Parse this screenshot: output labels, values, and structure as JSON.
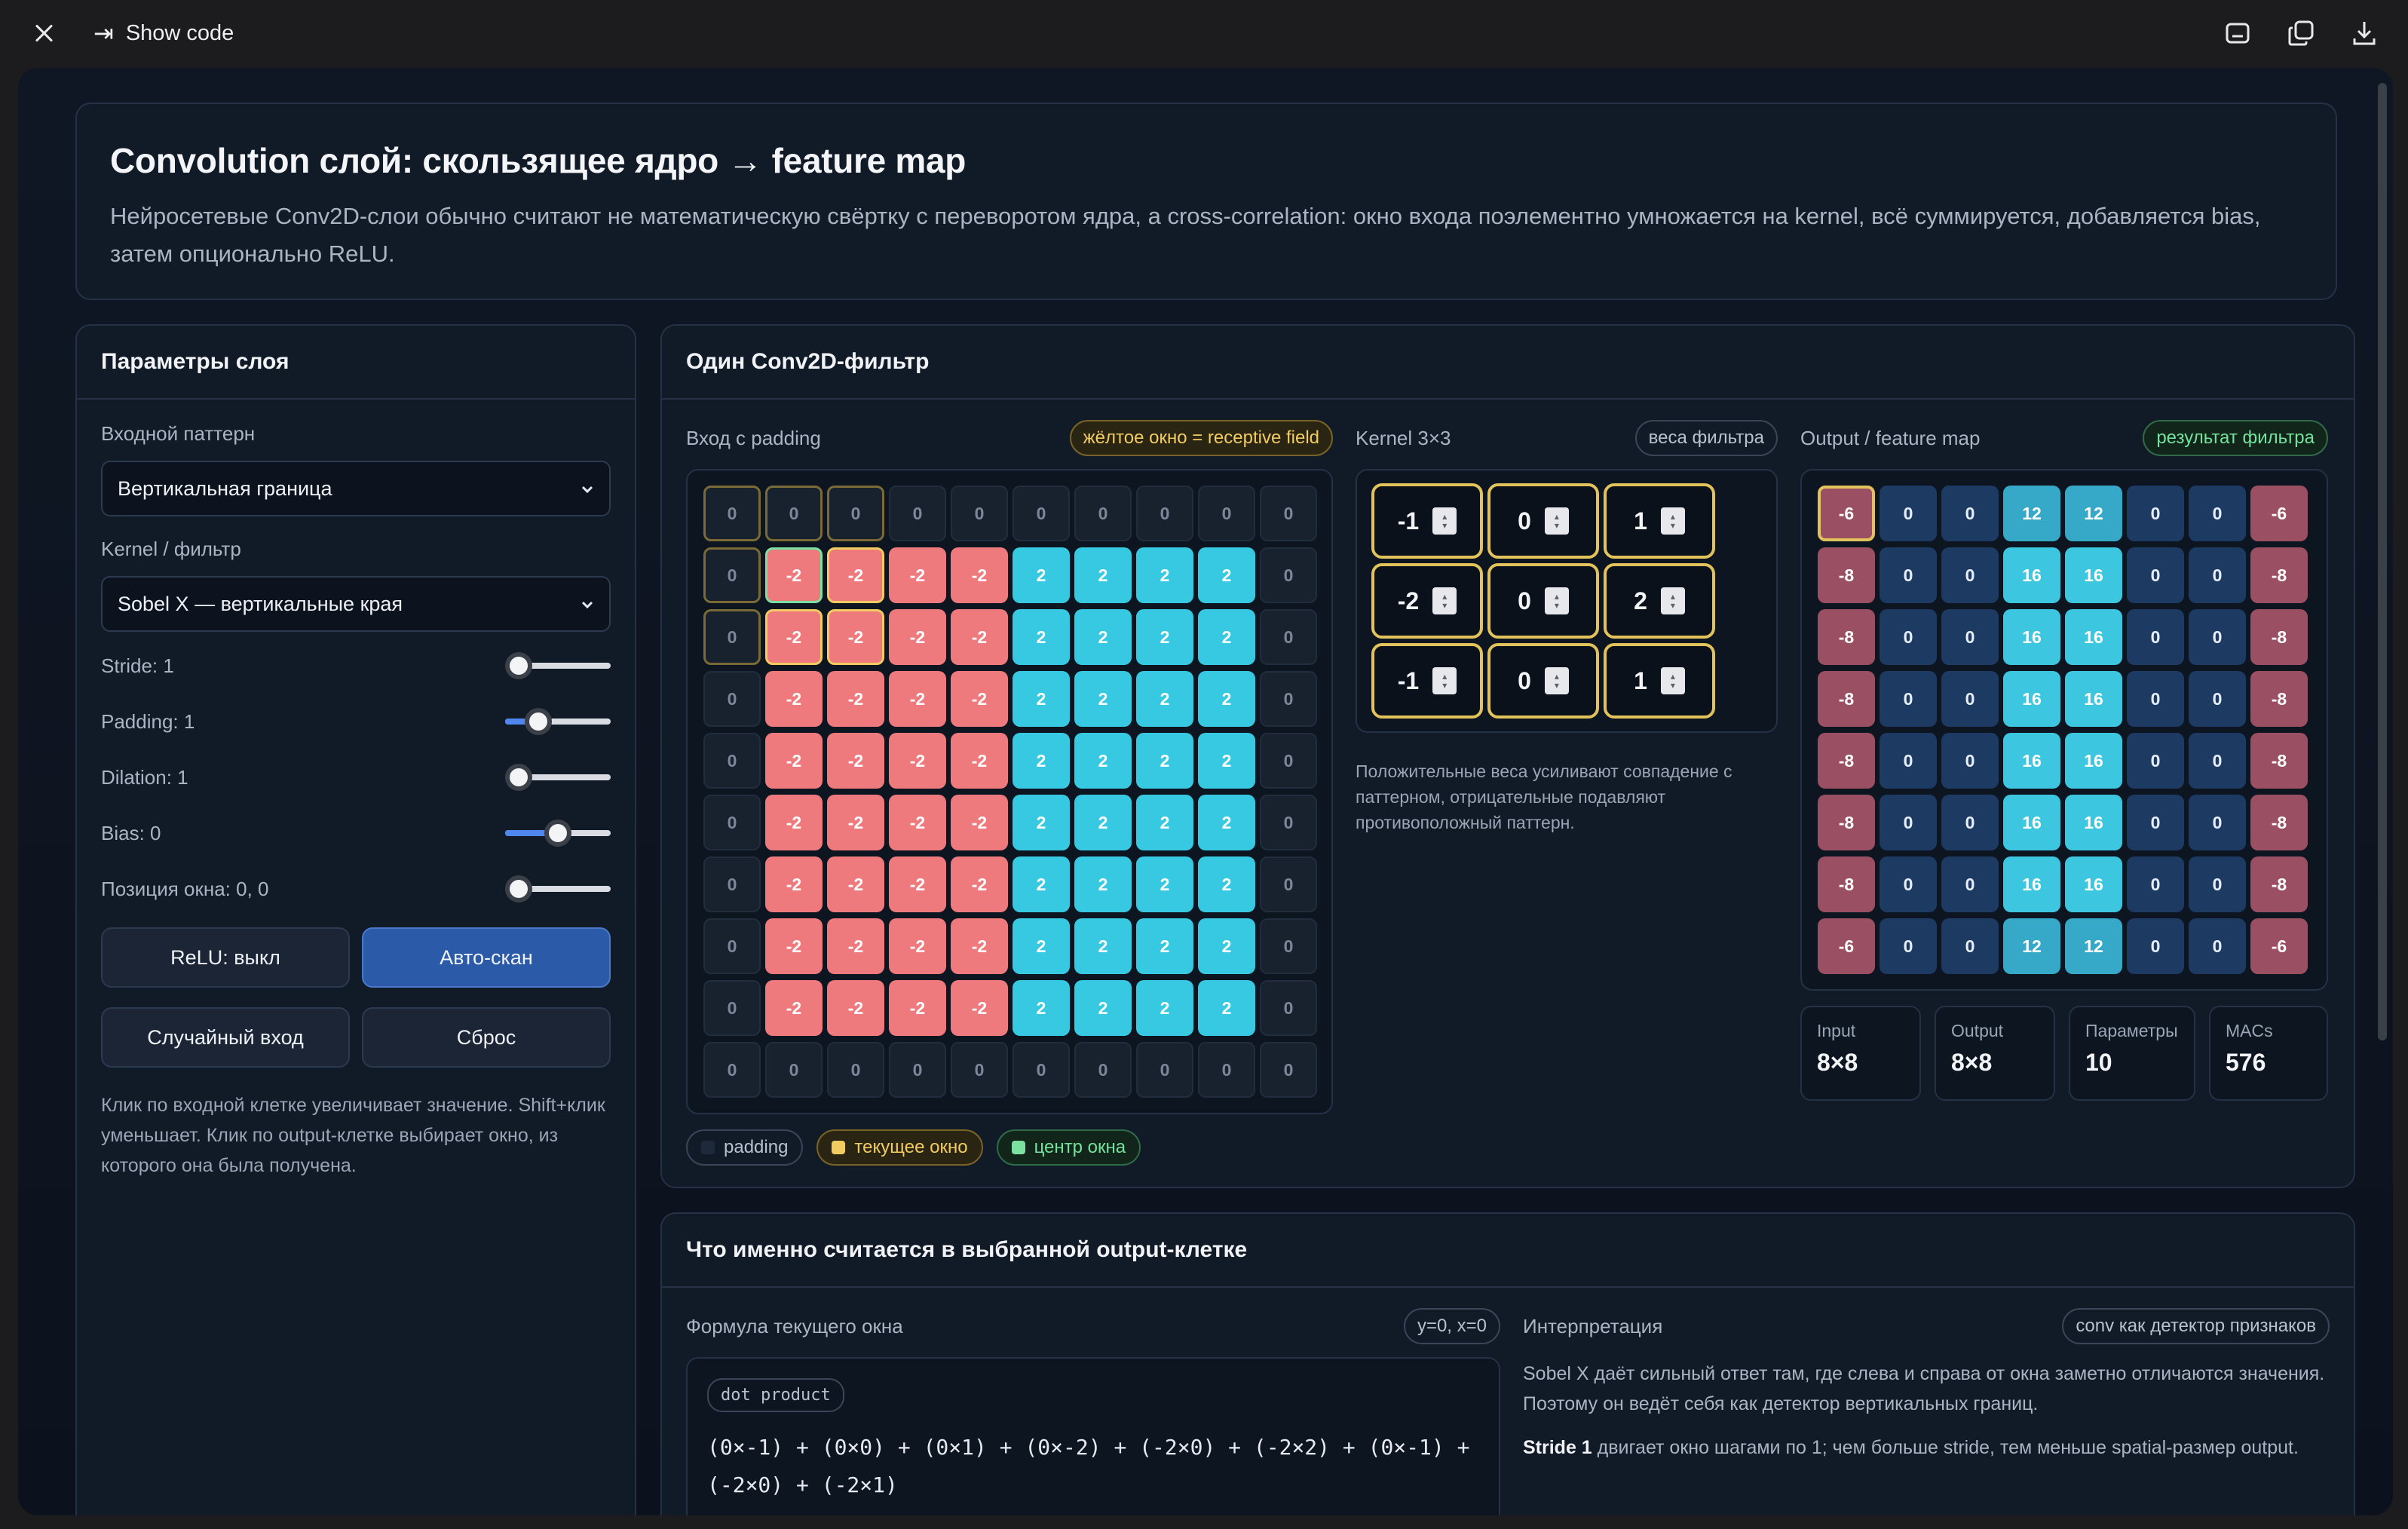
{
  "chrome": {
    "show_code": "Show code"
  },
  "hero": {
    "title": "Convolution слой: скользящее ядро → feature map",
    "description": "Нейросетевые Conv2D-слои обычно считают не математическую свёртку с переворотом ядра, а cross-correlation: окно входа поэлементно умножается на kernel, всё суммируется, добавляется bias, затем опционально ReLU."
  },
  "params": {
    "title": "Параметры слоя",
    "pattern_label": "Входной паттерн",
    "pattern_value": "Вертикальная граница",
    "kernel_label": "Kernel / фильтр",
    "kernel_value": "Sobel X — вертикальные края",
    "sliders": [
      {
        "label": "Stride: 1",
        "level": 0.0
      },
      {
        "label": "Padding: 1",
        "level": 0.25
      },
      {
        "label": "Dilation: 1",
        "level": 0.0
      },
      {
        "label": "Bias: 0",
        "level": 0.5
      },
      {
        "label": "Позиция окна: 0, 0",
        "level": 0.0
      }
    ],
    "relu_button": "ReLU: выкл",
    "autoscan_button": "Авто-скан",
    "random_button": "Случайный вход",
    "reset_button": "Сброс",
    "hint": "Клик по входной клетке увеличивает значение. Shift+клик уменьшает. Клик по output-клетке выбирает окно, из которого она была получена."
  },
  "conv": {
    "title": "Один Conv2D-фильтр",
    "input_title": "Вход с padding",
    "input_badge": "жёлтое окно = receptive field",
    "kernel_title": "Kernel 3×3",
    "kernel_badge": "веса фильтра",
    "output_title": "Output / feature map",
    "output_badge": "результат фильтра",
    "kernel_note": "Положительные веса усиливают совпадение с паттерном, отрицательные подавляют противоположный паттерн.",
    "input_grid": [
      [
        0,
        0,
        0,
        0,
        0,
        0,
        0,
        0,
        0,
        0
      ],
      [
        0,
        -2,
        -2,
        -2,
        -2,
        2,
        2,
        2,
        2,
        0
      ],
      [
        0,
        -2,
        -2,
        -2,
        -2,
        2,
        2,
        2,
        2,
        0
      ],
      [
        0,
        -2,
        -2,
        -2,
        -2,
        2,
        2,
        2,
        2,
        0
      ],
      [
        0,
        -2,
        -2,
        -2,
        -2,
        2,
        2,
        2,
        2,
        0
      ],
      [
        0,
        -2,
        -2,
        -2,
        -2,
        2,
        2,
        2,
        2,
        0
      ],
      [
        0,
        -2,
        -2,
        -2,
        -2,
        2,
        2,
        2,
        2,
        0
      ],
      [
        0,
        -2,
        -2,
        -2,
        -2,
        2,
        2,
        2,
        2,
        0
      ],
      [
        0,
        -2,
        -2,
        -2,
        -2,
        2,
        2,
        2,
        2,
        0
      ],
      [
        0,
        0,
        0,
        0,
        0,
        0,
        0,
        0,
        0,
        0
      ]
    ],
    "kernel": [
      [
        -1,
        0,
        1
      ],
      [
        -2,
        0,
        2
      ],
      [
        -1,
        0,
        1
      ]
    ],
    "output_grid": [
      [
        -6,
        0,
        0,
        12,
        12,
        0,
        0,
        -6
      ],
      [
        -8,
        0,
        0,
        16,
        16,
        0,
        0,
        -8
      ],
      [
        -8,
        0,
        0,
        16,
        16,
        0,
        0,
        -8
      ],
      [
        -8,
        0,
        0,
        16,
        16,
        0,
        0,
        -8
      ],
      [
        -8,
        0,
        0,
        16,
        16,
        0,
        0,
        -8
      ],
      [
        -8,
        0,
        0,
        16,
        16,
        0,
        0,
        -8
      ],
      [
        -8,
        0,
        0,
        16,
        16,
        0,
        0,
        -8
      ],
      [
        -6,
        0,
        0,
        12,
        12,
        0,
        0,
        -6
      ]
    ],
    "stats": [
      {
        "label": "Input",
        "value": "8×8"
      },
      {
        "label": "Output",
        "value": "8×8"
      },
      {
        "label": "Параметры",
        "value": "10"
      },
      {
        "label": "MACs",
        "value": "576"
      }
    ],
    "legend": {
      "padding": "padding",
      "window": "текущее окно",
      "center": "центр окна"
    },
    "colors": {
      "negative": "#ef7a7e",
      "positive": "#37c9e2",
      "window": "#e2c25a",
      "center": "#7be0a0"
    }
  },
  "calc": {
    "title": "Что именно считается в выбранной output-клетке",
    "formula_title": "Формула текущего окна",
    "formula_badge": "y=0, x=0",
    "formula_tag": "dot product",
    "formula": "(0×-1) + (0×0) + (0×1) + (0×-2) + (-2×0) + (-2×2) + (0×-1) + (-2×0) + (-2×1)",
    "interp_title": "Интерпретация",
    "interp_badge": "conv как детектор признаков",
    "interp_text": "Sobel X даёт сильный ответ там, где слева и справа от окна заметно отличаются значения. Поэтому он ведёт себя как детектор вертикальных границ.",
    "stride_bold": "Stride 1",
    "stride_text": " двигает окно шагами по 1; чем больше stride, тем меньше spatial-размер output."
  }
}
